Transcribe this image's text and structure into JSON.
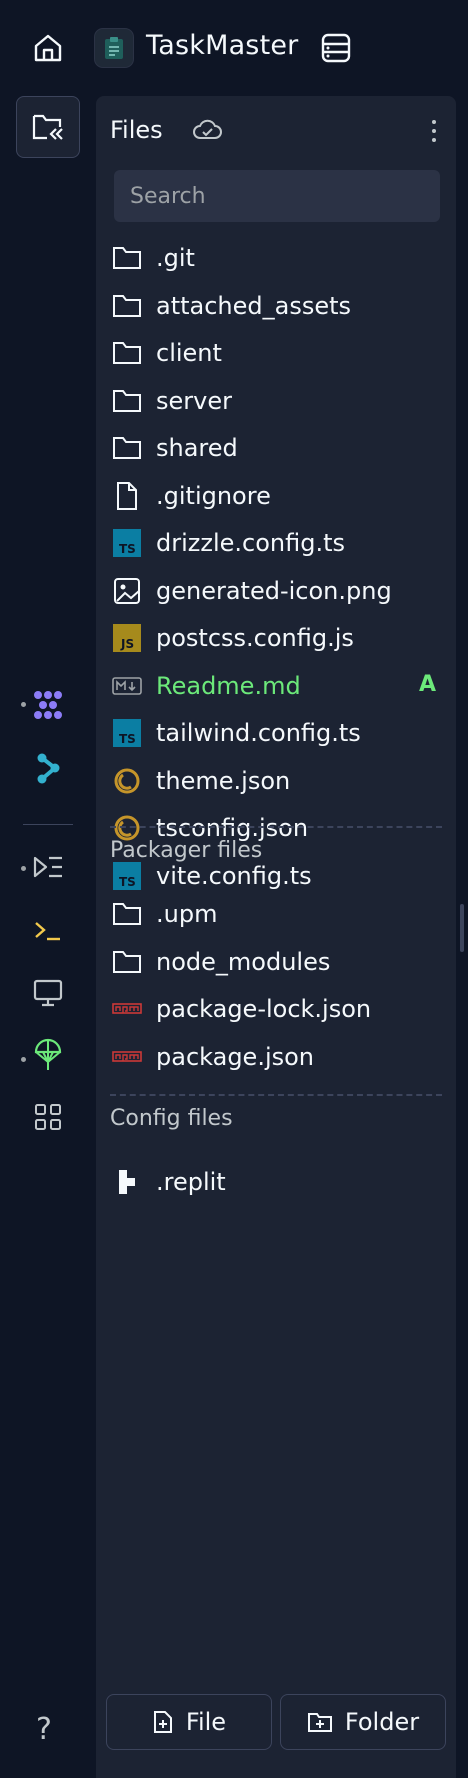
{
  "header": {
    "app_title": "TaskMaster"
  },
  "rail": {
    "items": [
      {
        "icon": "folder-collapse-icon",
        "active": true
      },
      {
        "icon": "agent-icon",
        "color": "#8c7cf7"
      },
      {
        "icon": "assistant-icon",
        "color": "#33b1cf"
      },
      {
        "icon": "workflows-icon",
        "color": "#c2c8cc"
      },
      {
        "icon": "shell-icon",
        "color": "#f2c94c"
      },
      {
        "icon": "webview-icon",
        "color": "#c2c8cc"
      },
      {
        "icon": "deployments-icon",
        "color": "#6ce97a"
      },
      {
        "icon": "all-tools-icon",
        "color": "#c2c8cc"
      }
    ],
    "help": "?"
  },
  "panel": {
    "title": "Files",
    "search_placeholder": "Search",
    "files": [
      {
        "name": ".git",
        "icon": "folder-icon"
      },
      {
        "name": "attached_assets",
        "icon": "folder-icon"
      },
      {
        "name": "client",
        "icon": "folder-icon"
      },
      {
        "name": "server",
        "icon": "folder-icon"
      },
      {
        "name": "shared",
        "icon": "folder-icon"
      },
      {
        "name": ".gitignore",
        "icon": "file-icon"
      },
      {
        "name": "drizzle.config.ts",
        "icon": "typescript-icon"
      },
      {
        "name": "generated-icon.png",
        "icon": "image-icon"
      },
      {
        "name": "postcss.config.js",
        "icon": "javascript-icon"
      },
      {
        "name": "Readme.md",
        "icon": "markdown-icon",
        "badge": "A"
      },
      {
        "name": "tailwind.config.ts",
        "icon": "typescript-icon"
      },
      {
        "name": "theme.json",
        "icon": "json-icon"
      },
      {
        "name": "tsconfig.json",
        "icon": "json-icon"
      },
      {
        "name": "vite.config.ts",
        "icon": "typescript-icon"
      }
    ],
    "packager": {
      "label": "Packager files",
      "files": [
        {
          "name": ".upm",
          "icon": "folder-icon"
        },
        {
          "name": "node_modules",
          "icon": "folder-icon"
        },
        {
          "name": "package-lock.json",
          "icon": "npm-icon"
        },
        {
          "name": "package.json",
          "icon": "npm-icon"
        }
      ]
    },
    "config": {
      "label": "Config files",
      "files": [
        {
          "name": ".replit",
          "icon": "replit-icon"
        }
      ]
    },
    "new_file_label": "File",
    "new_folder_label": "Folder"
  },
  "colors": {
    "background": "#0e1525",
    "panel": "#1c2333",
    "added": "#6ce97a"
  }
}
